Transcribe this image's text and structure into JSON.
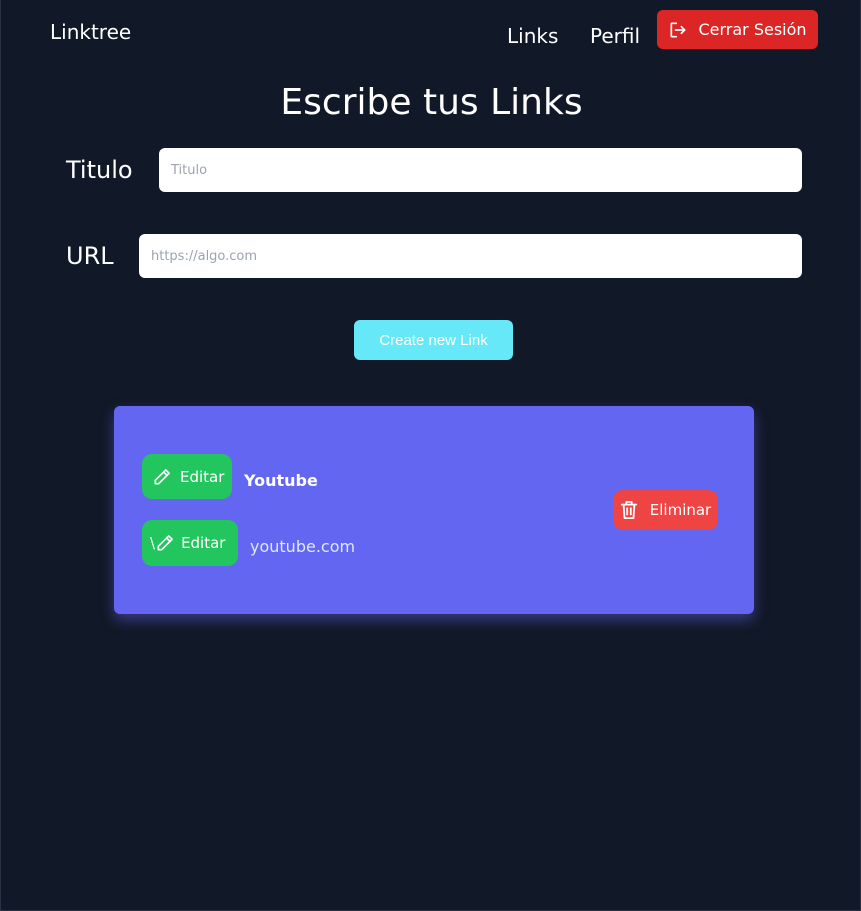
{
  "navbar": {
    "brand": "Linktree",
    "links_label": "Links",
    "profile_label": "Perfil",
    "logout_label": "Cerrar Sesión"
  },
  "form": {
    "heading": "Escribe tus Links",
    "title_label": "Titulo",
    "title_placeholder": "Titulo",
    "title_value": "",
    "url_label": "URL",
    "url_placeholder": "https://algo.com",
    "url_value": "",
    "create_label": "Create new Link"
  },
  "links": [
    {
      "title": "Youtube",
      "url": "youtube.com",
      "edit_title_label": "Editar",
      "edit_url_prefix": "\\",
      "edit_url_label": "Editar",
      "delete_label": "Eliminar"
    }
  ],
  "colors": {
    "background": "#111827",
    "logout": "#dc2626",
    "create": "#67e8f9",
    "card": "#6366f1",
    "edit": "#22c55e",
    "delete": "#ef4444"
  },
  "icons": {
    "logout": "logout-icon",
    "edit": "pencil-icon",
    "delete": "trash-icon"
  }
}
